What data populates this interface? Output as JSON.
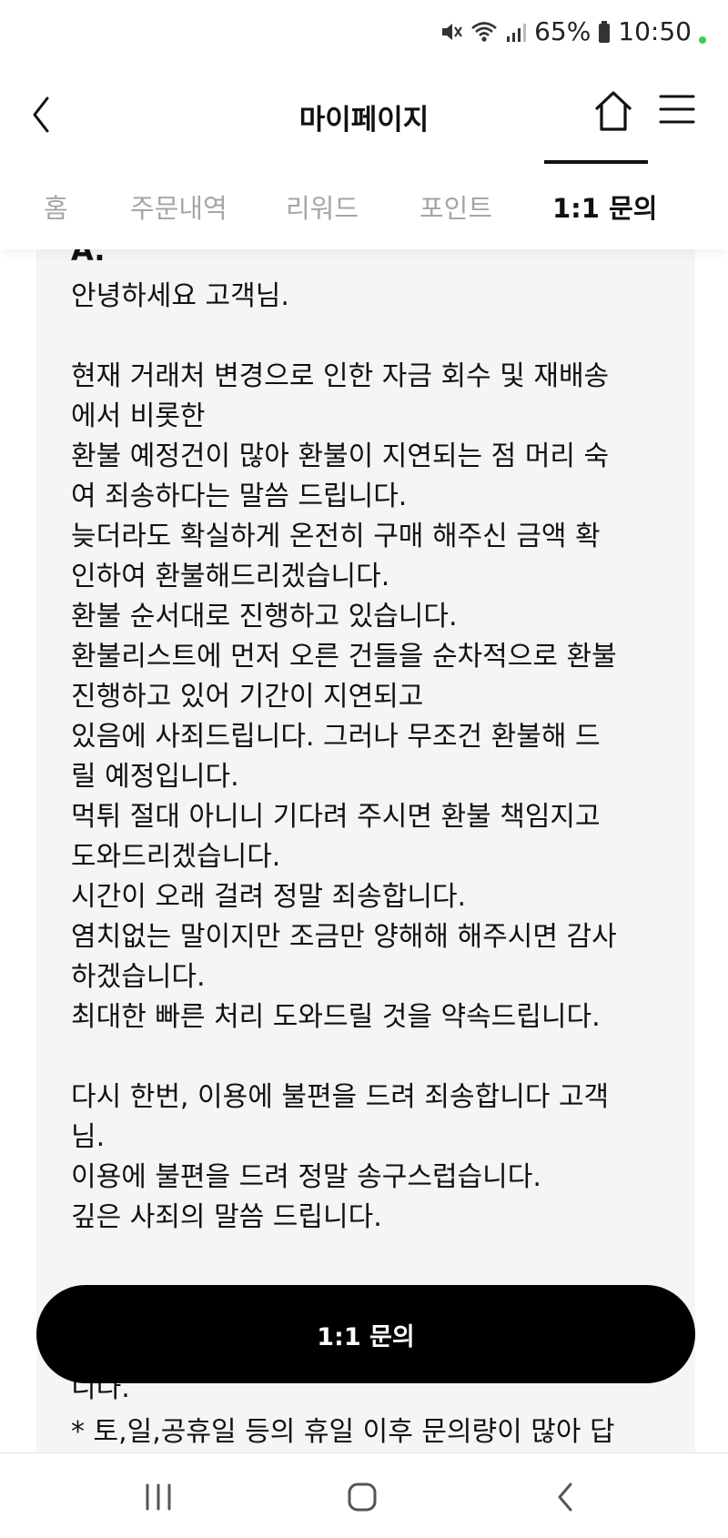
{
  "status_bar": {
    "battery": "65%",
    "time": "10:50",
    "icons": [
      "mute-icon",
      "wifi-icon",
      "signal-icon",
      "battery-icon"
    ]
  },
  "header": {
    "title": "마이페이지",
    "icons": [
      "back-arrow-icon",
      "home-icon",
      "hamburger-menu-icon"
    ]
  },
  "tabs": [
    {
      "label": "홈",
      "active": false
    },
    {
      "label": "주문내역",
      "active": false
    },
    {
      "label": "리워드",
      "active": false
    },
    {
      "label": "포인트",
      "active": false
    },
    {
      "label": "1:1 문의",
      "active": true
    }
  ],
  "answer": {
    "marker": "A.",
    "body": "안녕하세요 고객님.\n\n현재 거래처 변경으로 인한 자금 회수 및 재배송\n에서 비롯한\n환불 예정건이 많아 환불이 지연되는 점 머리 숙\n여 죄송하다는 말씀 드립니다.\n늦더라도 확실하게 온전히 구매 해주신 금액 확\n인하여 환불해드리겠습니다.\n환불 순서대로 진행하고 있습니다.\n환불리스트에 먼저 오른 건들을 순차적으로 환불\n진행하고 있어 기간이 지연되고\n있음에 사죄드립니다. 그러나 무조건 환불해 드\n릴 예정입니다.\n먹튀 절대 아니니 기다려 주시면 환불 책임지고\n도와드리겠습니다.\n시간이 오래 걸려 정말 죄송합니다.\n염치없는 말이지만 조금만 양해해 해주시면 감사\n하겠습니다.\n최대한 빠른 처리 도와드릴 것을 약속드립니다.\n\n다시 한번, 이용에 불편을 드려 죄송합니다 고객\n님.\n이용에 불편을 드려 정말 송구스럽습니다.\n깊은 사죄의 말씀 드립니다.",
    "tail": "니다.\n* 토,일,공휴일 등의 휴일 이후 문의량이 많아 답"
  },
  "floating_button": {
    "label": "1:1 문의"
  },
  "bottom_nav": {
    "icons": [
      "recent-apps-icon",
      "home-nav-icon",
      "back-nav-icon"
    ]
  }
}
